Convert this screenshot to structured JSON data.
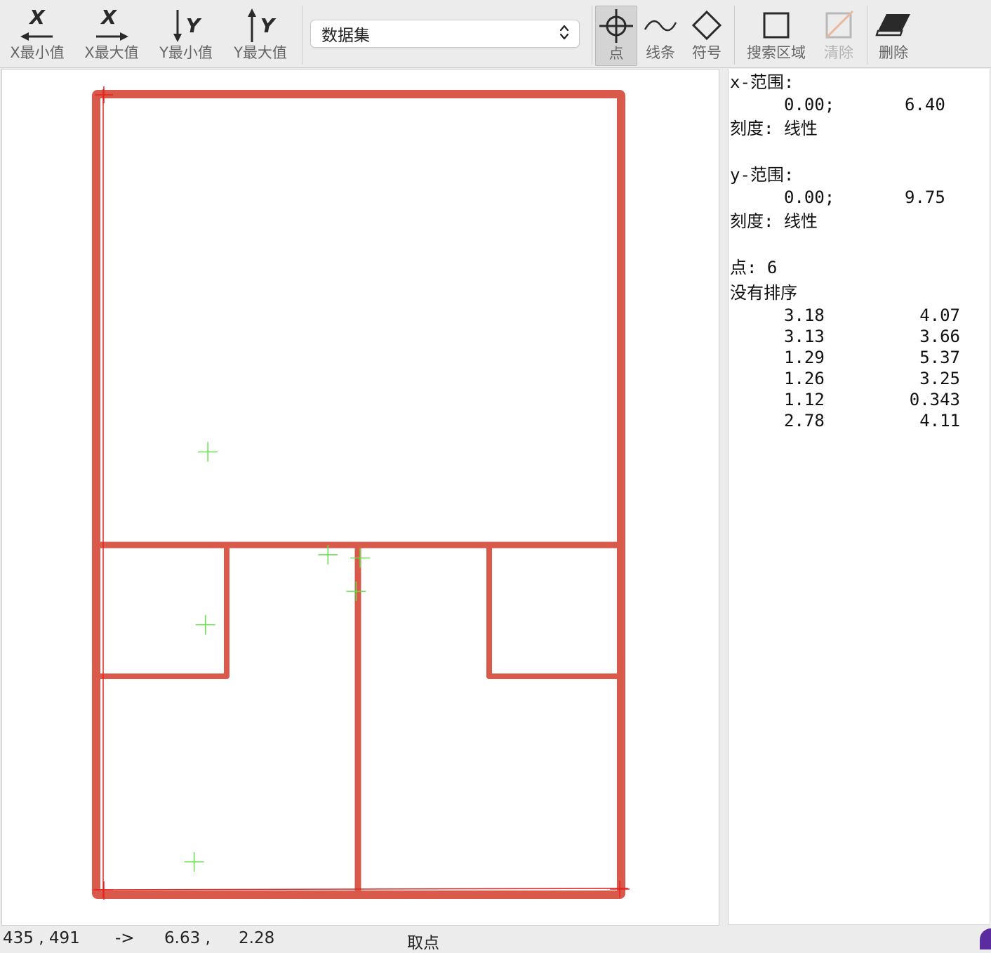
{
  "toolbar": {
    "xmin_label": "X最小值",
    "xmax_label": "X最大值",
    "ymin_label": "Y最小值",
    "ymax_label": "Y最大值",
    "dataset_select": "数据集",
    "point_label": "点",
    "line_label": "线条",
    "symbol_label": "符号",
    "search_region_label": "搜索区域",
    "clear_label": "清除",
    "delete_label": "删除",
    "active_tool": "点"
  },
  "icons": {
    "xmin": "x-min-arrow-left-icon",
    "xmax": "x-max-arrow-right-icon",
    "ymin": "y-min-arrow-down-icon",
    "ymax": "y-max-arrow-up-icon",
    "point": "crosshair-icon",
    "line": "tilde-line-icon",
    "symbol": "diamond-icon",
    "search_region": "square-icon",
    "clear": "square-slash-icon",
    "delete": "eraser-icon",
    "select": "chevron-updown-icon"
  },
  "info": {
    "x_range_label": "x-范围:",
    "x_min": "0.00;",
    "x_max": "6.40",
    "x_scale": "刻度: 线性",
    "y_range_label": "y-范围:",
    "y_min": "0.00;",
    "y_max": "9.75",
    "y_scale": "刻度: 线性",
    "points_count": "点: 6",
    "sort_state": "没有排序",
    "points": [
      {
        "x": "3.18",
        "y": "4.07"
      },
      {
        "x": "3.13",
        "y": "3.66"
      },
      {
        "x": "1.29",
        "y": "5.37"
      },
      {
        "x": "1.26",
        "y": "3.25"
      },
      {
        "x": "1.12",
        "y": "0.343"
      },
      {
        "x": "2.78",
        "y": "4.11"
      }
    ]
  },
  "status": {
    "pixel": "435 , 491",
    "arrow": "->",
    "value_x": "6.63 ,",
    "value_y": "2.28",
    "mode": "取点"
  },
  "colors": {
    "wall": "#d9594a",
    "axis_marker": "#e8231d",
    "point_marker": "#62e04a",
    "accent_corner": "#5b2ca0"
  }
}
